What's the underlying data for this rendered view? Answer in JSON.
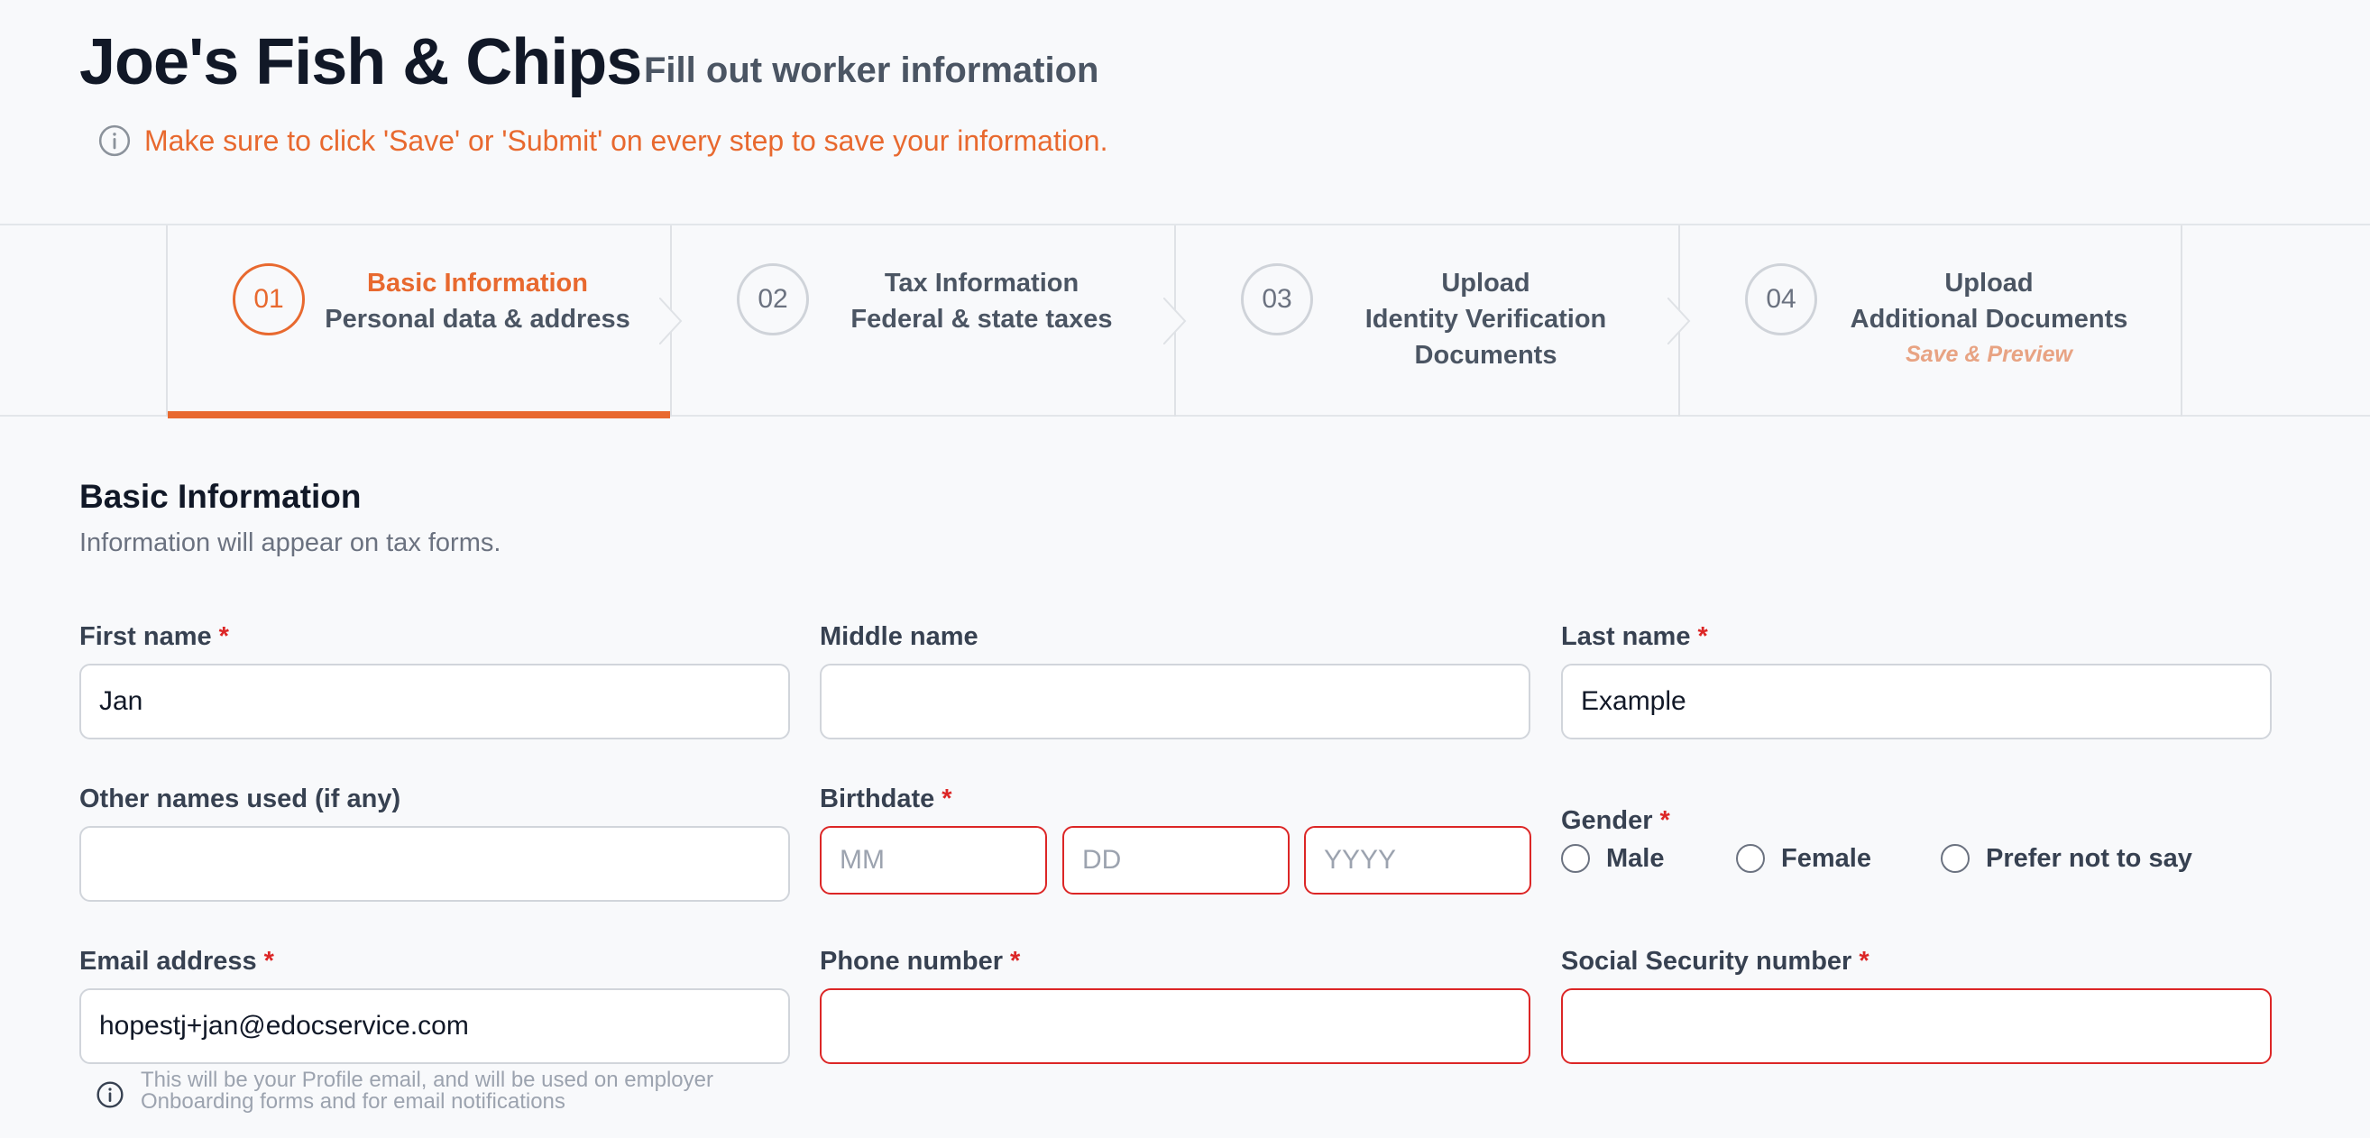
{
  "header": {
    "company": "Joe's Fish & Chips",
    "subtitle": "Fill out worker information",
    "notice": "Make sure to click 'Save' or 'Submit' on every step to save your information."
  },
  "steps": [
    {
      "number": "01",
      "title": "Basic Information",
      "sub": "Personal data & address",
      "active": true
    },
    {
      "number": "02",
      "title": "Tax Information",
      "sub": "Federal & state taxes"
    },
    {
      "number": "03",
      "title": "Upload",
      "sub": "Identity Verification",
      "sub2": "Documents"
    },
    {
      "number": "04",
      "title": "Upload",
      "sub": "Additional Documents",
      "note": "Save & Preview"
    }
  ],
  "section": {
    "title": "Basic Information",
    "description": "Information will appear on tax forms."
  },
  "form": {
    "required_mark": "*",
    "first_name": {
      "label": "First name",
      "value": "Jan"
    },
    "middle_name": {
      "label": "Middle name",
      "value": ""
    },
    "last_name": {
      "label": "Last name",
      "value": "Example"
    },
    "other_names": {
      "label": "Other names used (if any)",
      "value": ""
    },
    "birthdate": {
      "label": "Birthdate",
      "mm": "MM",
      "dd": "DD",
      "yyyy": "YYYY"
    },
    "gender": {
      "label": "Gender",
      "options": [
        "Male",
        "Female",
        "Prefer not to say"
      ]
    },
    "email": {
      "label": "Email address",
      "value": "hopestj+jan@edocservice.com",
      "help": "This will be your Profile email, and will be used on employer Onboarding forms and for email notifications"
    },
    "phone": {
      "label": "Phone number",
      "value": ""
    },
    "ssn": {
      "label": "Social Security number",
      "value": ""
    }
  },
  "colors": {
    "accent": "#e8692f",
    "error": "#dc2626"
  }
}
